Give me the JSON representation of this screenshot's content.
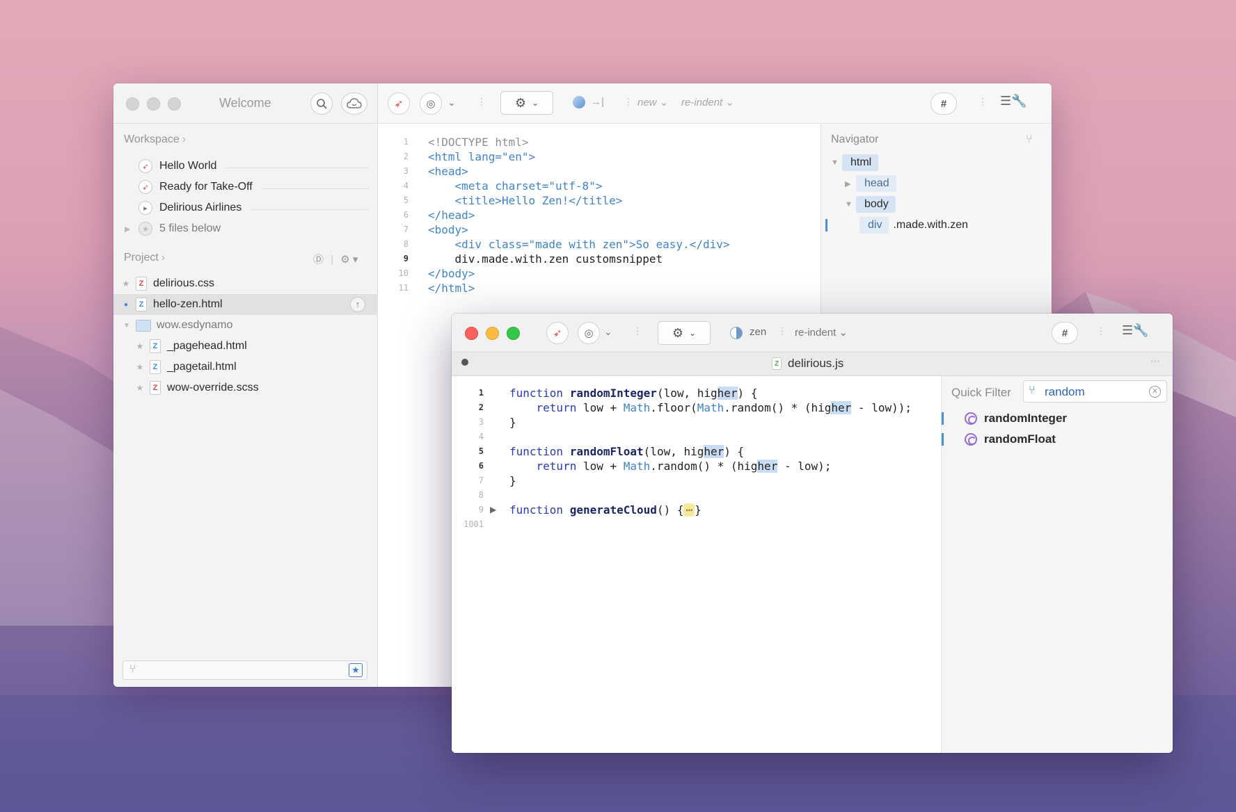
{
  "window_main": {
    "sidebar": {
      "title": "Welcome",
      "workspace_label": "Workspace",
      "workspace_items": [
        {
          "label": "Hello World"
        },
        {
          "label": "Ready for Take-Off"
        },
        {
          "label": "Delirious Airlines"
        },
        {
          "label": "5 files below"
        }
      ],
      "project_label": "Project",
      "files": [
        {
          "label": "delirious.css"
        },
        {
          "label": "hello-zen.html"
        },
        {
          "label": "wow.esdynamo"
        },
        {
          "label": "_pagehead.html"
        },
        {
          "label": "_pagetail.html"
        },
        {
          "label": "wow-override.scss"
        }
      ]
    },
    "toolbar": {
      "mode_label": "new",
      "indent_label": "re-indent",
      "hash_label": "#"
    },
    "editor": {
      "line_numbers": [
        "1",
        "2",
        "3",
        "4",
        "5",
        "6",
        "7",
        "8",
        "9",
        "10",
        "11"
      ],
      "lines": [
        "<!DOCTYPE html>",
        "<html lang=\"en\">",
        "<head>",
        "    <meta charset=\"utf-8\">",
        "    <title>Hello Zen!</title>",
        "</head>",
        "<body>",
        "    <div class=\"made with zen\">So easy.</div>",
        "    div.made.with.zen customsnippet",
        "</body>",
        "</html>"
      ],
      "current_line": "9"
    },
    "navigator": {
      "title": "Navigator",
      "nodes": [
        {
          "tag": "html"
        },
        {
          "tag": "head"
        },
        {
          "tag": "body"
        },
        {
          "tag": "div",
          "detail": ".made.with.zen"
        }
      ]
    }
  },
  "window_js": {
    "toolbar": {
      "mode_label": "zen",
      "indent_label": "re-indent",
      "hash_label": "#"
    },
    "tab": {
      "filename": "delirious.js"
    },
    "editor": {
      "line_numbers": [
        "1",
        "2",
        "3",
        "4",
        "5",
        "6",
        "7",
        "8",
        "9",
        "1001"
      ],
      "fold_marker": "⋯"
    },
    "quick_filter": {
      "label": "Quick Filter",
      "query": "random",
      "results": [
        {
          "label": "randomInteger"
        },
        {
          "label": "randomFloat"
        }
      ]
    }
  }
}
